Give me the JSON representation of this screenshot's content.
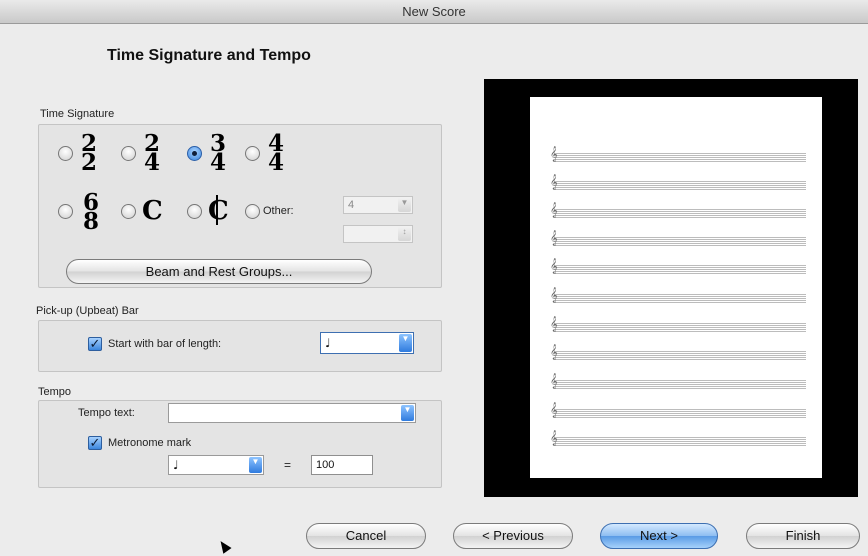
{
  "window": {
    "title": "New Score"
  },
  "page_heading": "Time Signature and Tempo",
  "time_signature": {
    "section_label": "Time Signature",
    "options": [
      {
        "top": "2",
        "bottom": "2"
      },
      {
        "top": "2",
        "bottom": "4"
      },
      {
        "top": "3",
        "bottom": "4"
      },
      {
        "top": "4",
        "bottom": "4"
      },
      {
        "top": "6",
        "bottom": "8"
      }
    ],
    "common_symbol": "C",
    "cut_symbol": "C",
    "other_label": "Other:",
    "other_value": "4",
    "other_denominator": "",
    "beam_button": "Beam and Rest Groups..."
  },
  "pickup": {
    "section_label": "Pick-up (Upbeat) Bar",
    "checkbox_label": "Start with bar of length:",
    "note_value": "♩"
  },
  "tempo": {
    "section_label": "Tempo",
    "tempo_text_label": "Tempo text:",
    "tempo_text_value": "",
    "metronome_label": "Metronome mark",
    "metronome_note": "♩",
    "equals": "=",
    "metronome_value": "100"
  },
  "preview": {
    "staff_count": 11,
    "clef_symbol": "𝄞"
  },
  "buttons": {
    "cancel": "Cancel",
    "previous": "< Previous",
    "next": "Next >",
    "finish": "Finish"
  },
  "colors": {
    "accent": "#5a9be5",
    "preview_background": "#000000"
  }
}
